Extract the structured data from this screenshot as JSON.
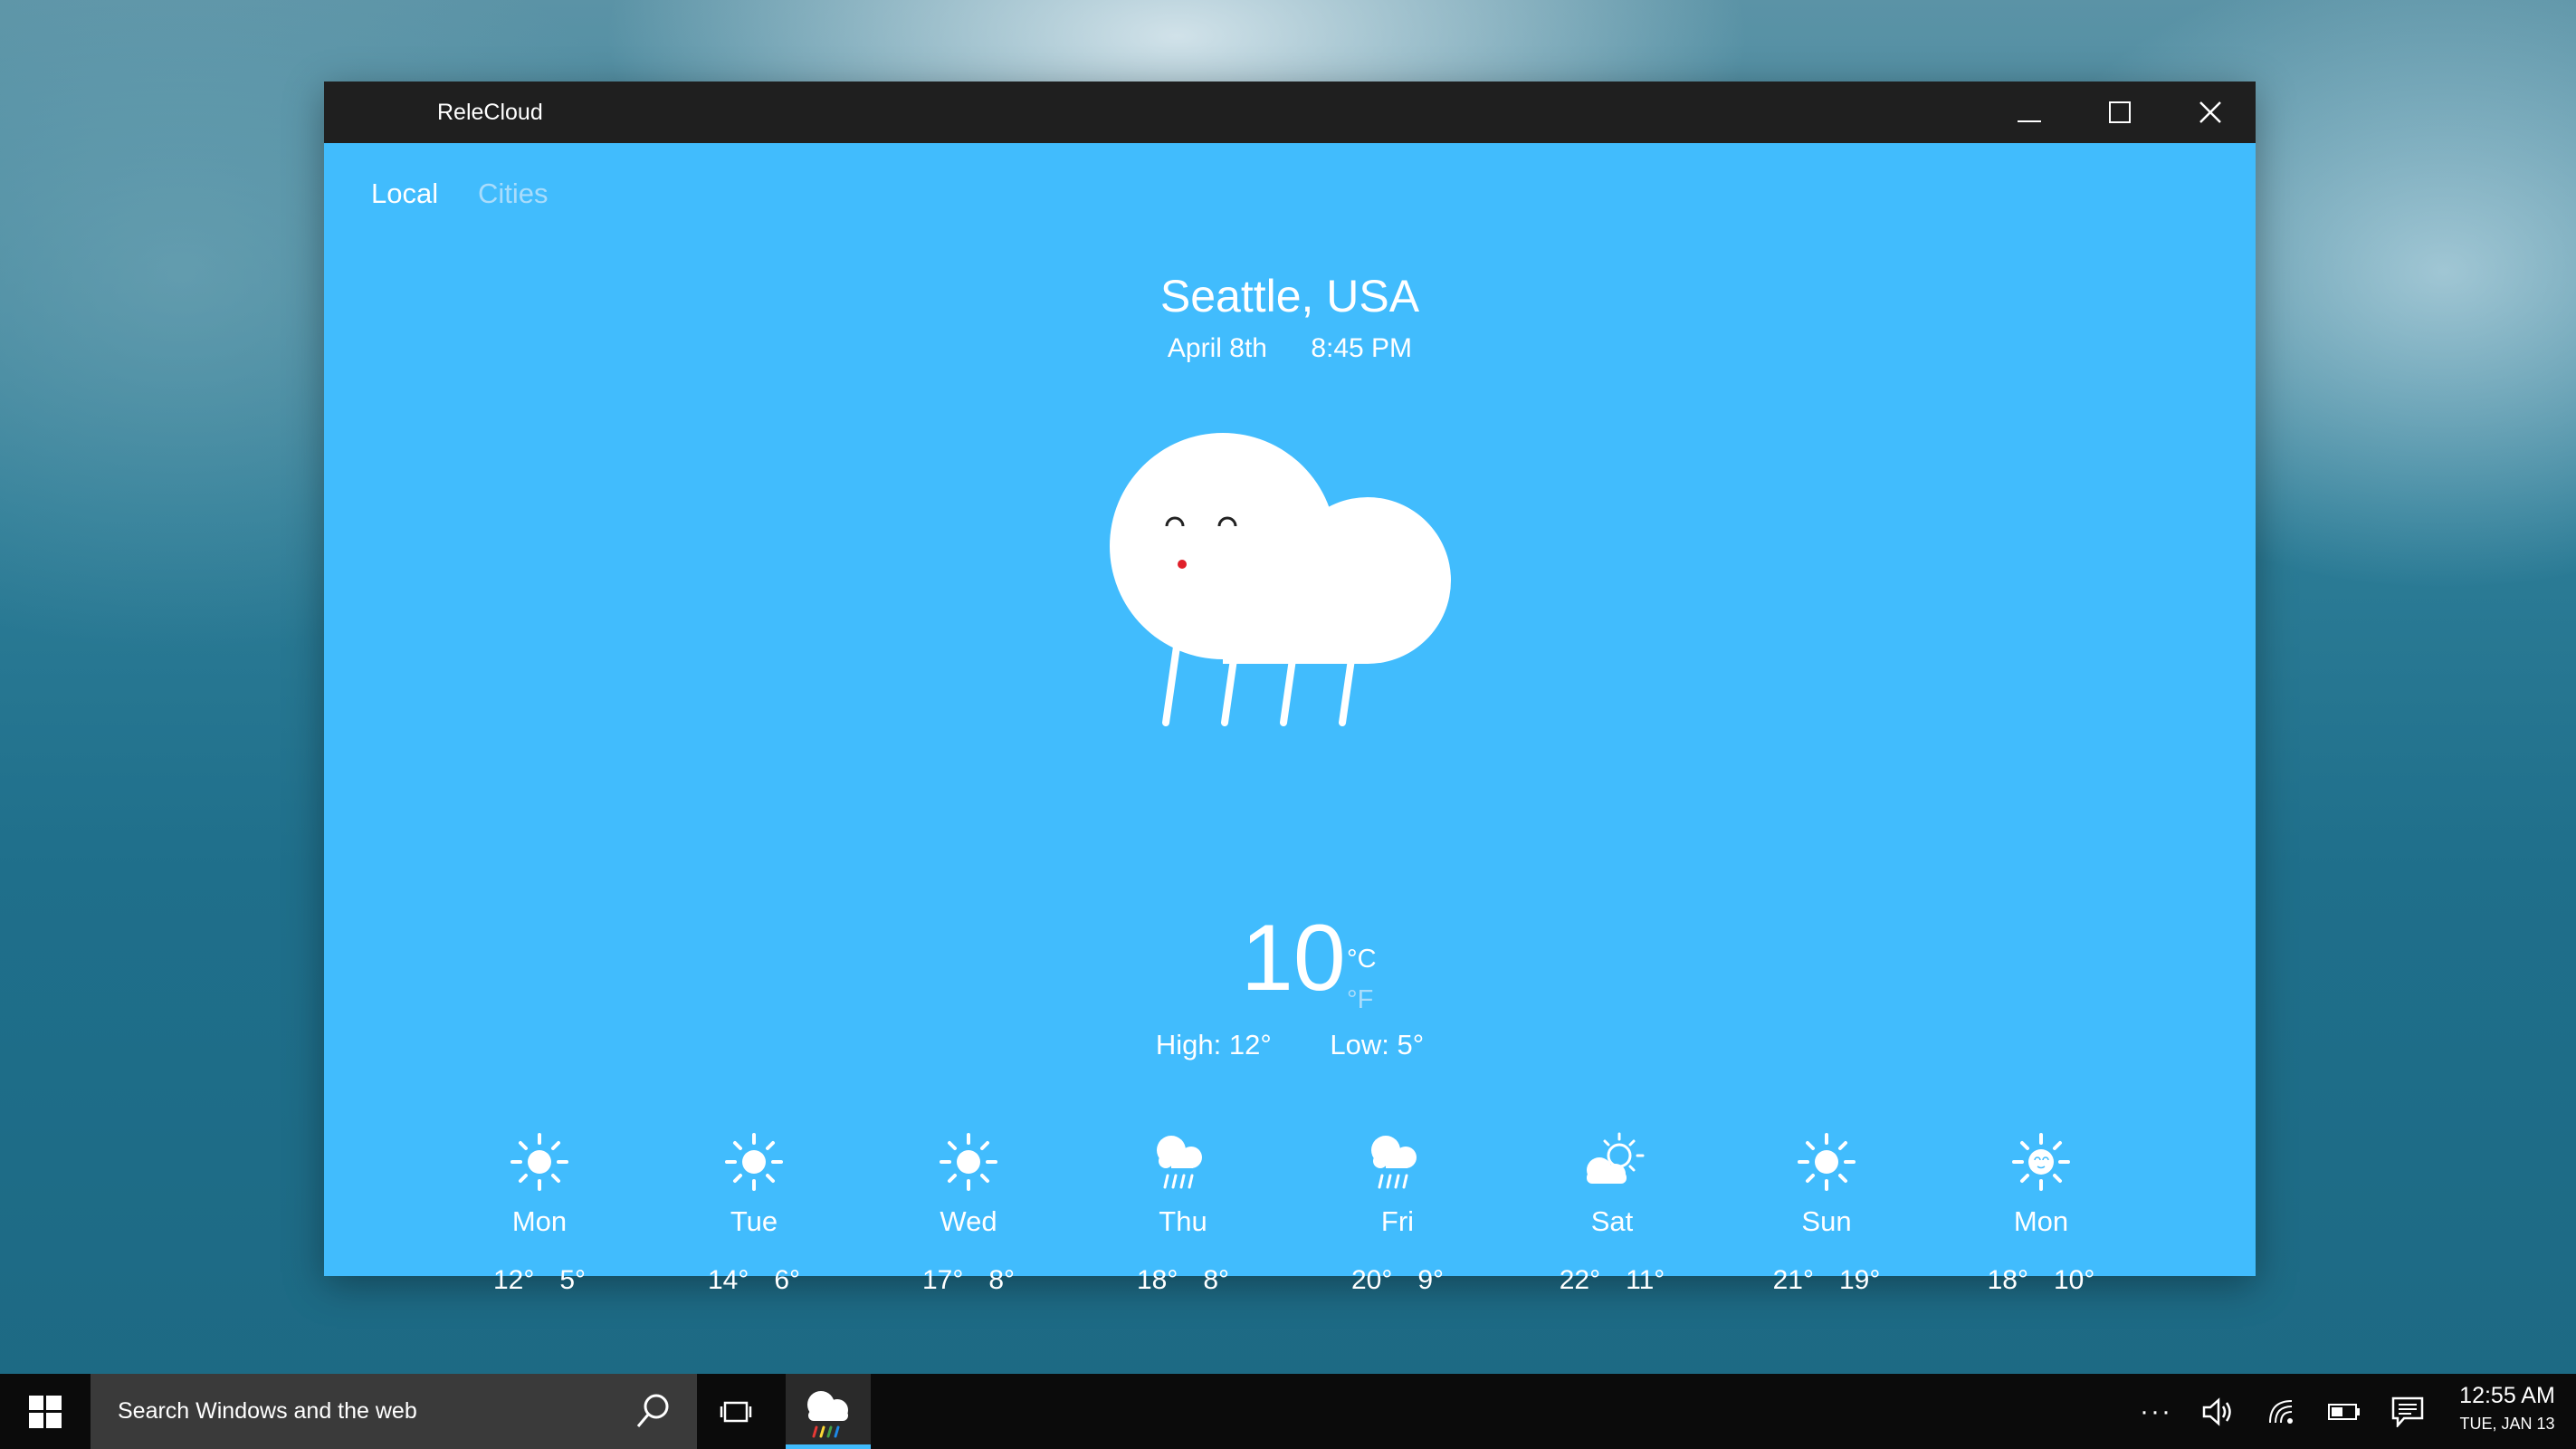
{
  "window": {
    "title": "ReleCloud"
  },
  "tabs": [
    {
      "label": "Local",
      "active": true
    },
    {
      "label": "Cities",
      "active": false
    }
  ],
  "current": {
    "city": "Seattle, USA",
    "date": "April 8th",
    "time": "8:45 PM",
    "temperature": "10",
    "unit_c": "°C",
    "unit_f": "°F",
    "high": "High: 12°",
    "low": "Low: 5°",
    "condition_icon": "rain-cloud-icon"
  },
  "forecast": [
    {
      "day": "Mon",
      "high": "12°",
      "low": "5°",
      "icon": "sun-icon"
    },
    {
      "day": "Tue",
      "high": "14°",
      "low": "6°",
      "icon": "sun-icon"
    },
    {
      "day": "Wed",
      "high": "17°",
      "low": "8°",
      "icon": "sun-icon"
    },
    {
      "day": "Thu",
      "high": "18°",
      "low": "8°",
      "icon": "rain-icon"
    },
    {
      "day": "Fri",
      "high": "20°",
      "low": "9°",
      "icon": "rain-icon"
    },
    {
      "day": "Sat",
      "high": "22°",
      "low": "11°",
      "icon": "partly-cloudy-icon"
    },
    {
      "day": "Sun",
      "high": "21°",
      "low": "19°",
      "icon": "sun-icon"
    },
    {
      "day": "Mon",
      "high": "18°",
      "low": "10°",
      "icon": "sun-face-icon"
    }
  ],
  "taskbar": {
    "search_placeholder": "Search Windows and the web",
    "time": "12:55 AM",
    "date": "TUE, JAN 13",
    "more": "···"
  },
  "colors": {
    "app_background": "#41bcfd",
    "titlebar": "#1f1f1f",
    "inactive_tab": "#a9dcfb"
  }
}
